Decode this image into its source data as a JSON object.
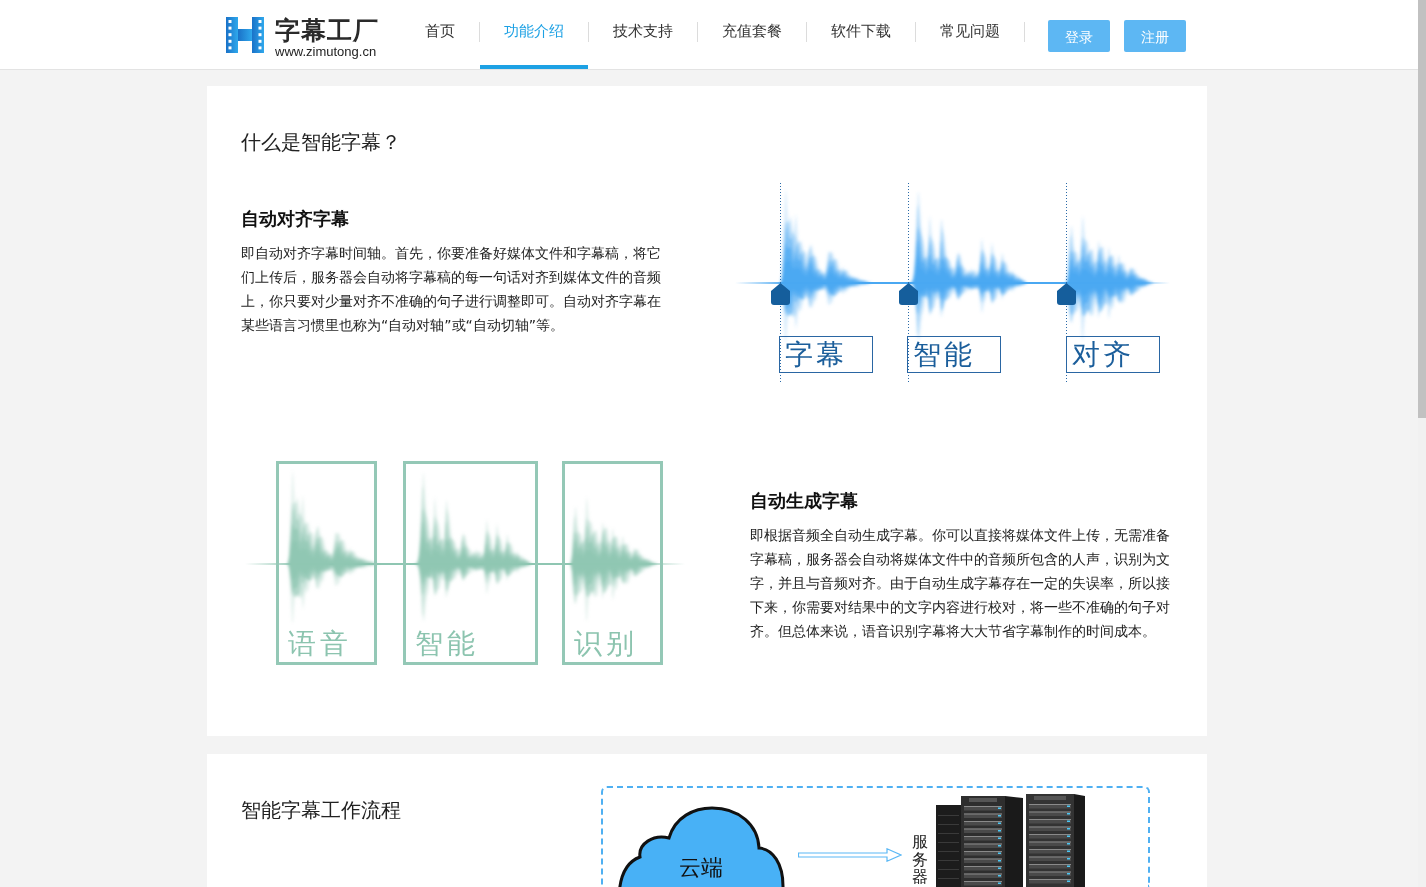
{
  "header": {
    "logo": {
      "title": "字幕工厂",
      "url": "www.zimutong.cn"
    },
    "nav": [
      {
        "label": "首页",
        "selected": false
      },
      {
        "label": "功能介绍",
        "selected": true
      },
      {
        "label": "技术支持",
        "selected": false
      },
      {
        "label": "充值套餐",
        "selected": false
      },
      {
        "label": "软件下载",
        "selected": false
      },
      {
        "label": "常见问题",
        "selected": false
      }
    ],
    "buttons": [
      "登录",
      "注册"
    ]
  },
  "intro": {
    "title": "什么是智能字幕？",
    "features": [
      {
        "kind": "alignment",
        "heading": "自动对齐字幕",
        "text": "即自动对齐字幕时间轴。首先，你要准备好媒体文件和字幕稿，将它们上传后，服务器会自动将字幕稿的每一句话对齐到媒体文件的音频上，你只要对少量对齐不准确的句子进行调整即可。自动对齐字幕在某些语言习惯里也称为“自动对轴”或“自动切轴”等。",
        "labels": [
          "字幕",
          "智能",
          "对齐"
        ]
      },
      {
        "kind": "generation",
        "heading": "自动生成字幕",
        "text": "即根据音频全自动生成字幕。你可以直接将媒体文件上传，无需准备字幕稿，服务器会自动将媒体文件中的音频所包含的人声，识别为文字，并且与音频对齐。由于自动生成字幕存在一定的失误率，所以接下来，你需要对结果中的文字内容进行校对，将一些不准确的句子对齐。但总体来说，语音识别字幕将大大节省字幕制作的时间成本。",
        "labels": [
          "语音",
          "智能",
          "识别"
        ]
      }
    ]
  },
  "workflow": {
    "title": "智能字幕工作流程",
    "cloud_label": "云端",
    "server_label": "服务器"
  }
}
